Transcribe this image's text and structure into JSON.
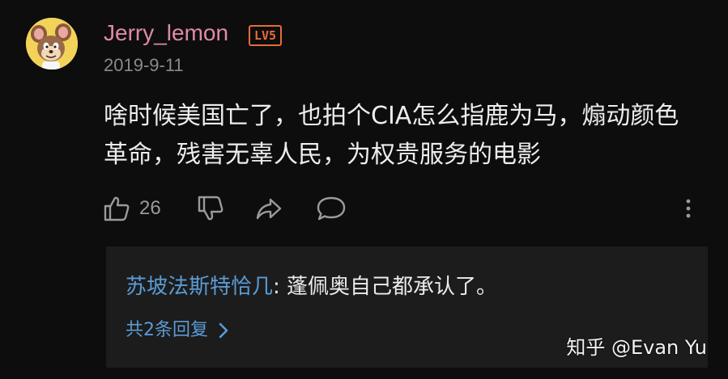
{
  "comment": {
    "author": "Jerry_lemon",
    "level": "LV5",
    "date": "2019-9-11",
    "text": "啥时候美国亡了，也拍个CIA怎么指鹿为马，煽动颜色革命，残害无辜人民，为权贵服务的电影",
    "likes": "26"
  },
  "reply": {
    "author": "苏坡法斯特恰几",
    "separator": ": ",
    "text": "蓬佩奥自己都承认了。",
    "more_label": "共2条回复"
  },
  "watermark": "知乎 @Evan Yu",
  "icons": {
    "like": "thumbs-up-icon",
    "dislike": "thumbs-down-icon",
    "share": "share-arrow-icon",
    "comment": "speech-bubble-icon",
    "more": "vertical-dots-icon",
    "expand": "chevron-right-icon"
  },
  "colors": {
    "background": "#0d0d0d",
    "username": "#e08aa8",
    "level_badge": "#e86b3a",
    "link_blue": "#5b9bd5",
    "reply_box": "#1c1c1c"
  }
}
